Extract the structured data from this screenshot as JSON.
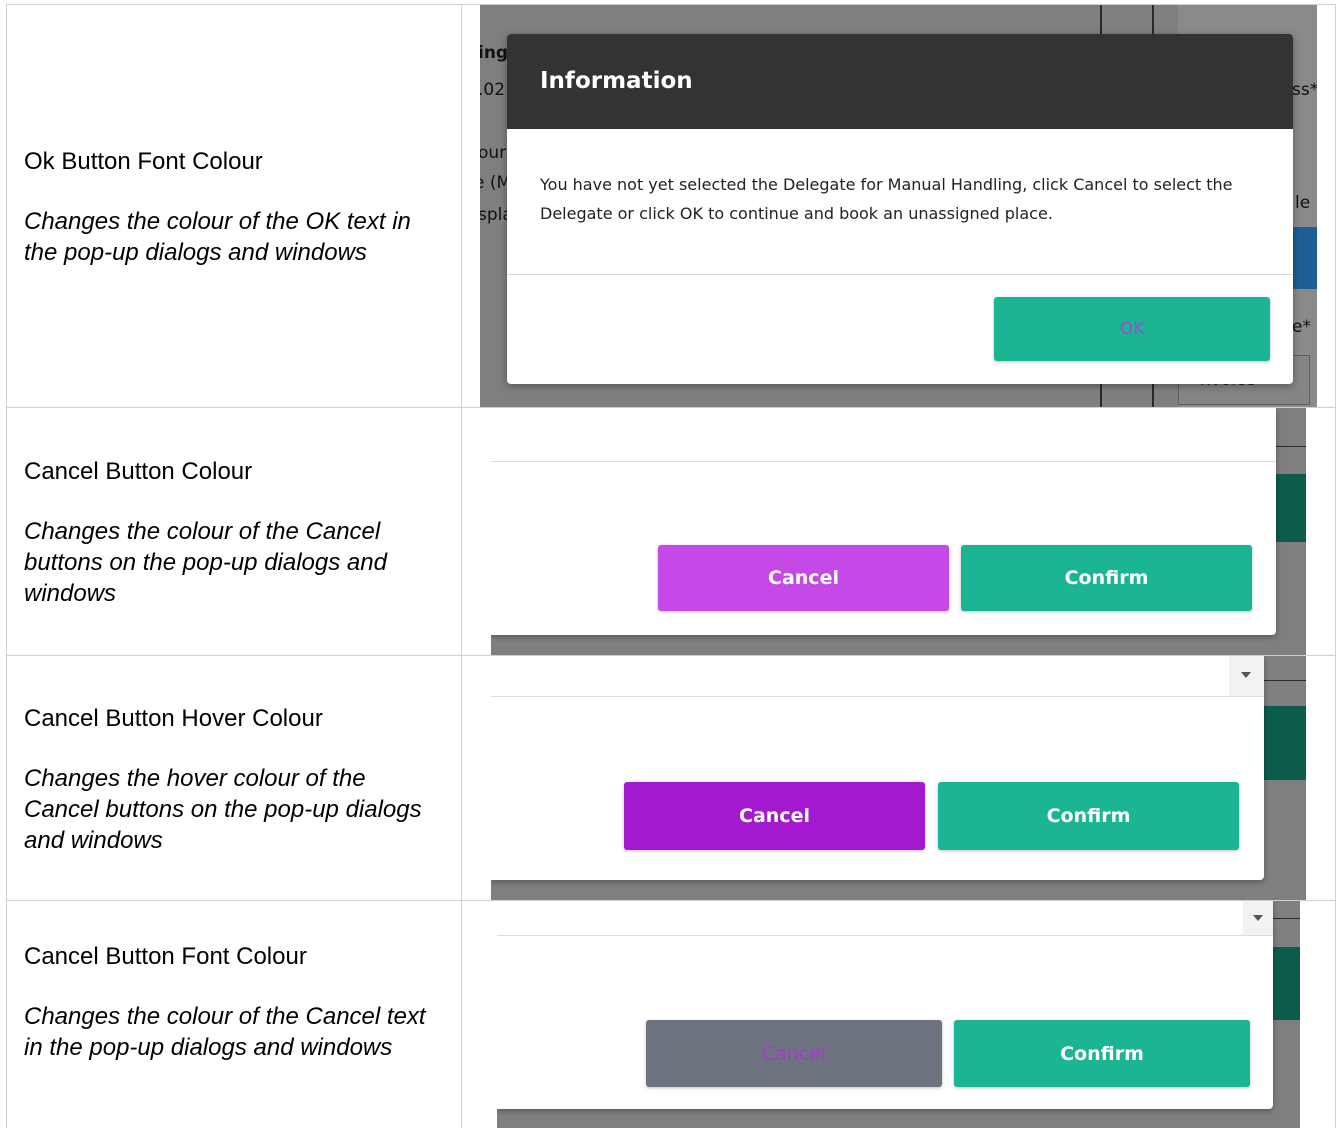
{
  "rows": [
    {
      "title": "Ok Button Font Colour",
      "description": "Changes the colour of the OK text in the pop-up dialogs and windows"
    },
    {
      "title": "Cancel Button Colour",
      "description": "Changes the colour of the Cancel buttons on the pop-up dialogs and windows"
    },
    {
      "title": "Cancel Button Hover Colour",
      "description": "Changes the hover colour of the Cancel buttons on the pop-up dialogs and windows"
    },
    {
      "title": "Cancel Button Font Colour",
      "description": "Changes the colour of the Cancel text in the pop-up dialogs and windows"
    }
  ],
  "shot1": {
    "dialog_title": "Information",
    "message": "You have not yet selected the Delegate for Manual Handling, click Cancel to select the Delegate or click OK to continue and book an unassigned place.",
    "ok_label": "OK",
    "bg_fragments": [
      "ing",
      ".02",
      "our",
      "e (M",
      "spla",
      "ss*",
      "le",
      "e*",
      "nvoice"
    ]
  },
  "shot2": {
    "cancel_label": "Cancel",
    "confirm_label": "Confirm"
  },
  "shot3": {
    "cancel_label": "Cancel",
    "confirm_label": "Confirm"
  },
  "shot4": {
    "cancel_label": "Cancel",
    "confirm_label": "Confirm"
  },
  "colors": {
    "overlay": "#7f7f7f",
    "dialog_header": "#333333",
    "teal": "#1bb594",
    "dark_teal": "#0c5c4b",
    "cancel": "#c449e6",
    "cancel_hover": "#a419cf",
    "cancel_grey": "#6d7480",
    "ok_text": "#9c4ccf",
    "cancel_text": "#a53ad0"
  }
}
